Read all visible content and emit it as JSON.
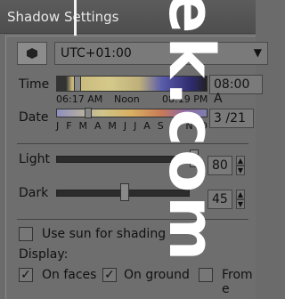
{
  "window": {
    "title": "Shadow Settings"
  },
  "timezone": {
    "value": "UTC+01:00"
  },
  "time": {
    "label": "Time",
    "start_label": "06:17 AM",
    "noon_label": "Noon",
    "end_label": "08:19 PM",
    "value": "08:00 A"
  },
  "date": {
    "label": "Date",
    "months": [
      "J",
      "F",
      "M",
      "A",
      "M",
      "J",
      "J",
      "A",
      "S",
      "O",
      "N",
      "D"
    ],
    "value": "3 /21"
  },
  "light": {
    "label": "Light",
    "value": "80"
  },
  "dark": {
    "label": "Dark",
    "value": "45"
  },
  "options": {
    "use_sun_label": "Use sun for shading",
    "display_label": "Display:",
    "on_faces_label": "On faces",
    "on_ground_label": "On ground",
    "from_edges_label": "From e"
  },
  "watermark": {
    "text": "ek.com"
  }
}
